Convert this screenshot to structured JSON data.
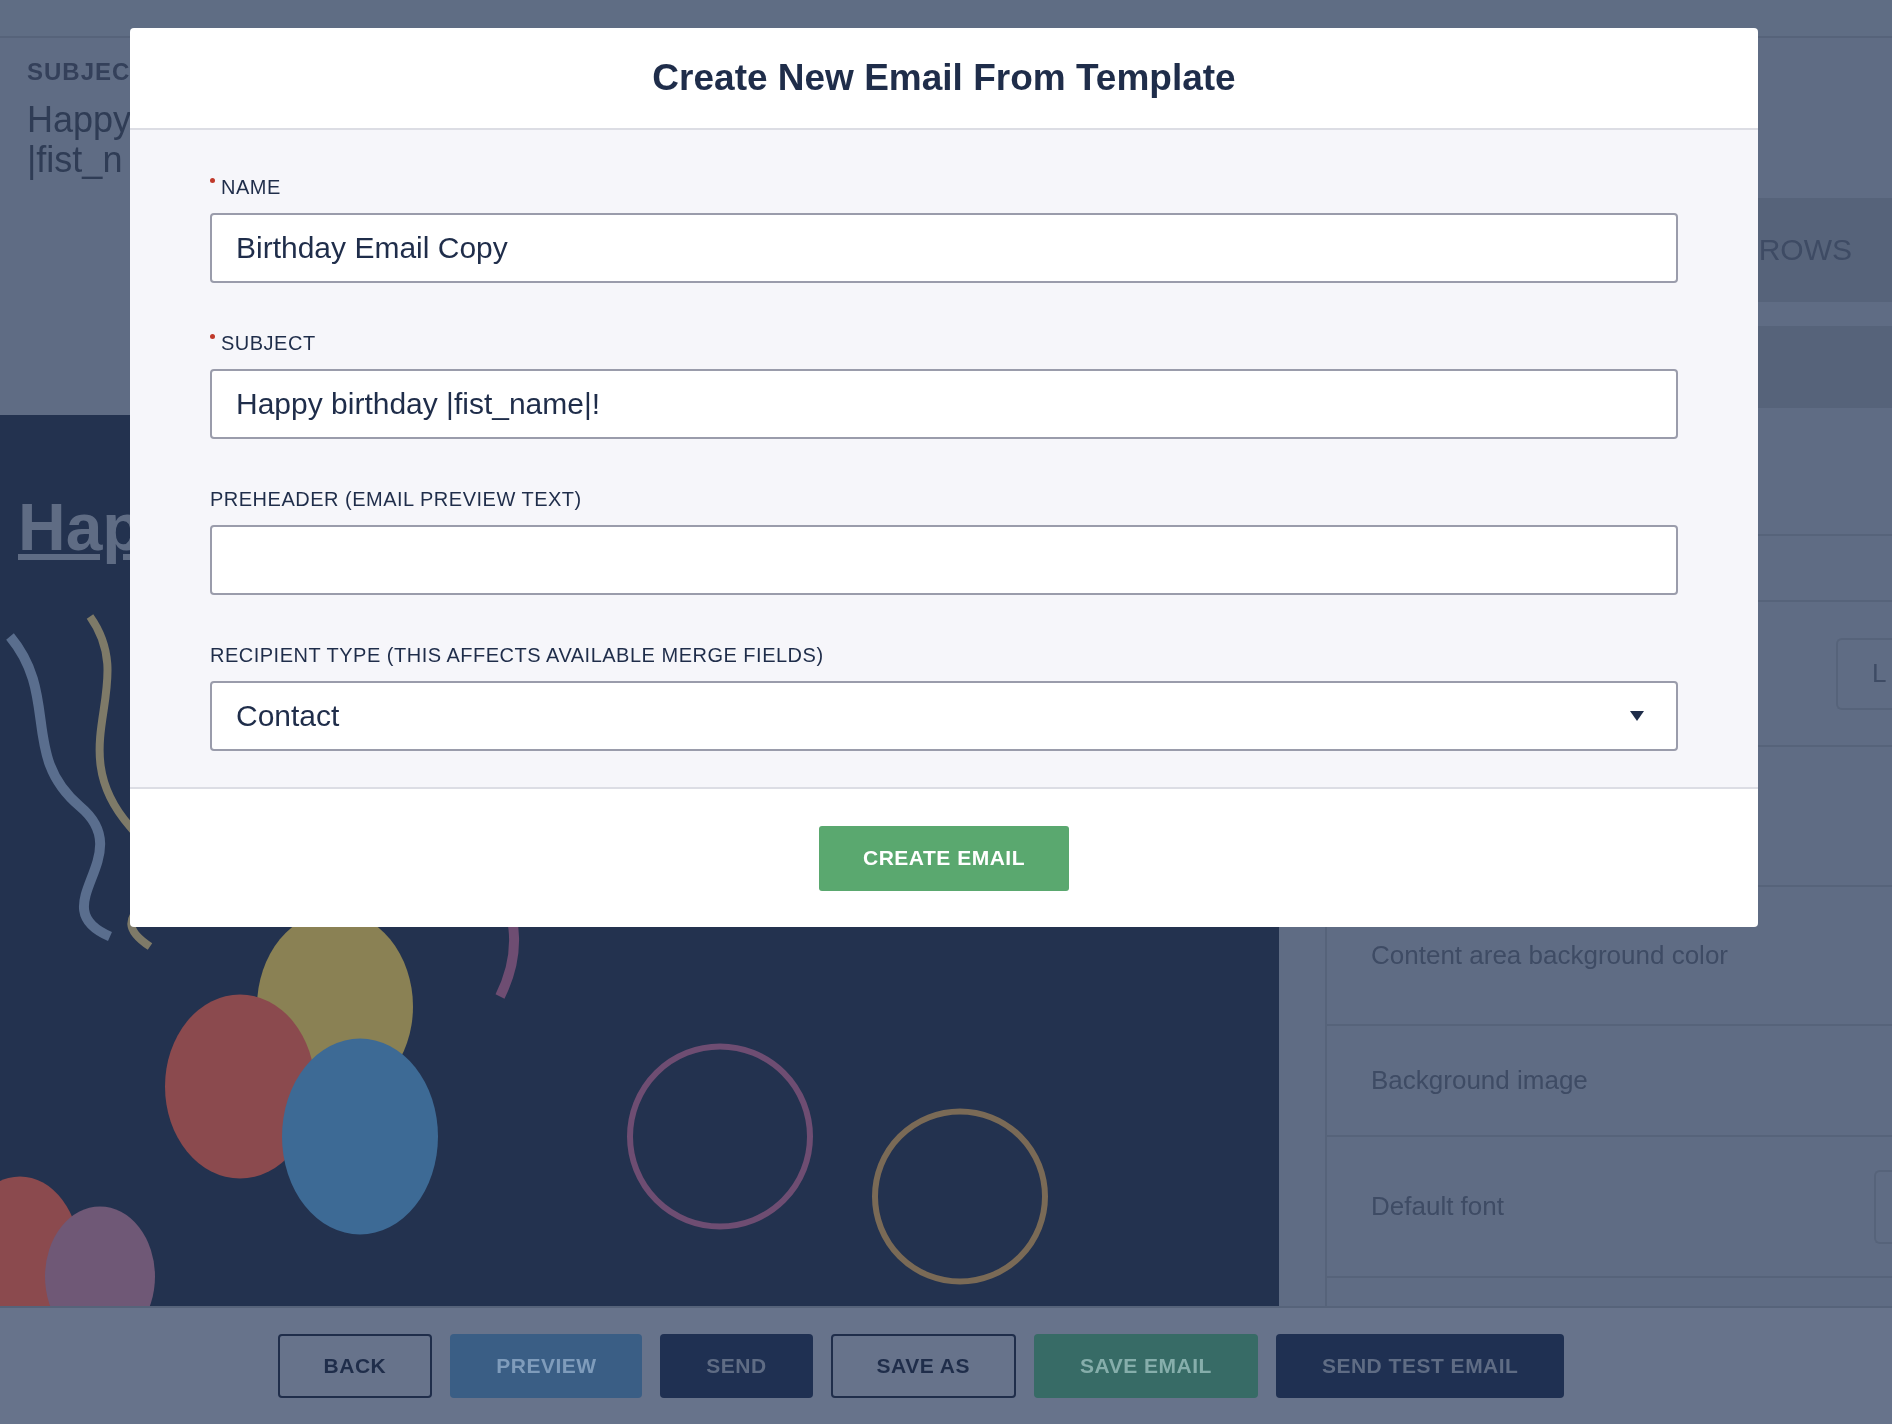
{
  "background": {
    "subject_label": "SUBJEC",
    "subject_lines": [
      "Happy",
      "|fist_n"
    ],
    "heading": "Hap",
    "tab": "ROWS",
    "side_button": "L",
    "settings": [
      {
        "label": "Content area background color",
        "kind": "plain"
      },
      {
        "label": "Background image",
        "kind": "plain"
      },
      {
        "label": "Default font",
        "kind": "dropdown"
      }
    ]
  },
  "modal": {
    "title": "Create New Email From Template",
    "fields": [
      {
        "label": "NAME",
        "required": true,
        "kind": "text",
        "value": "Birthday Email Copy"
      },
      {
        "label": "SUBJECT",
        "required": true,
        "kind": "text",
        "value": "Happy birthday |fist_name|!"
      },
      {
        "label": "PREHEADER (EMAIL PREVIEW TEXT)",
        "required": false,
        "kind": "text"
      },
      {
        "label": "RECIPIENT TYPE (THIS AFFECTS AVAILABLE MERGE FIELDS)",
        "required": false,
        "kind": "select",
        "value": "Contact"
      }
    ],
    "button": "CREATE EMAIL"
  },
  "toolbar": [
    {
      "label": "BACK",
      "kind": "outline"
    },
    {
      "label": "PREVIEW",
      "kind": "light"
    },
    {
      "label": "SEND",
      "kind": "dark"
    },
    {
      "label": "SAVE AS",
      "kind": "outline"
    },
    {
      "label": "SAVE EMAIL",
      "kind": "green"
    },
    {
      "label": "SEND TEST EMAIL",
      "kind": "dark"
    }
  ]
}
